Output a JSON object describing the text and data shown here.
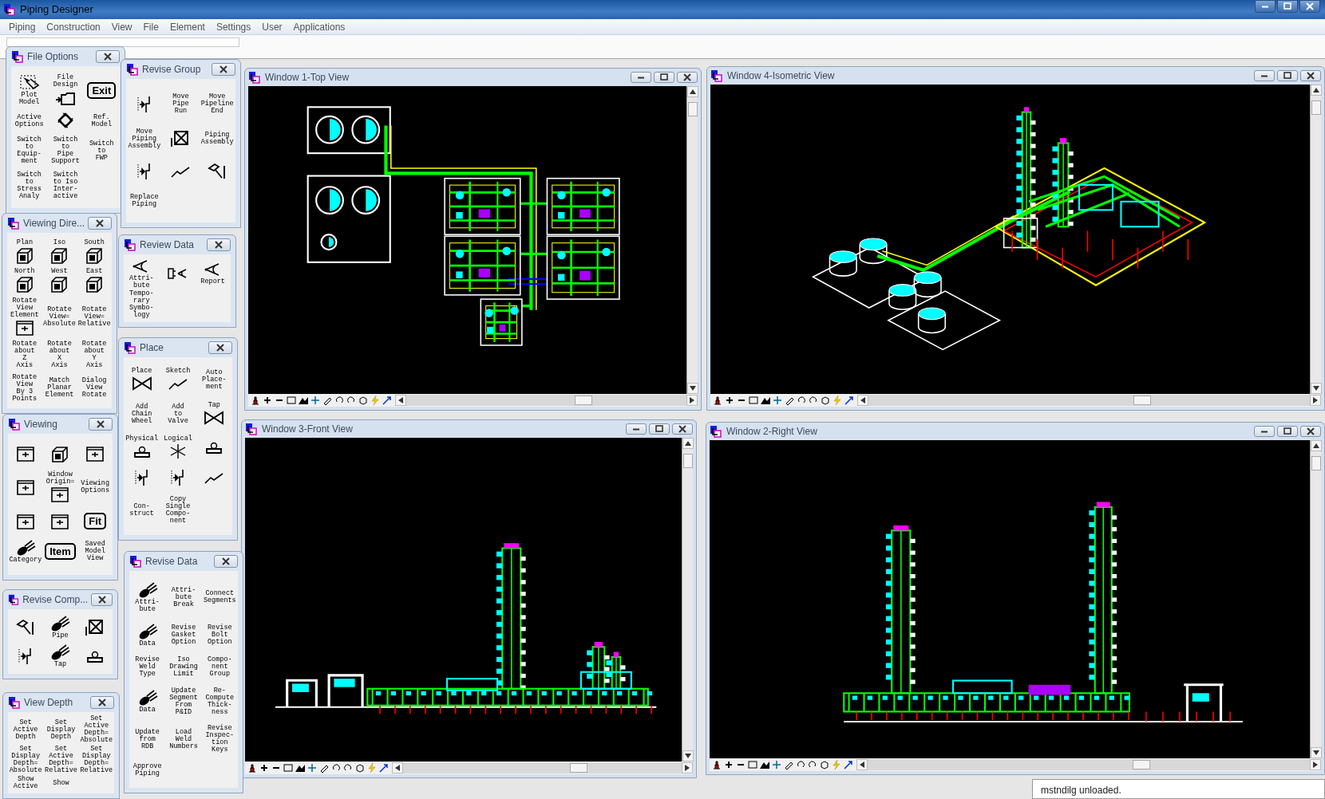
{
  "app": {
    "title": "Piping Designer"
  },
  "menu": [
    "Piping",
    "Construction",
    "View",
    "File",
    "Element",
    "Settings",
    "User",
    "Applications"
  ],
  "windows": [
    {
      "title": "Window 1-Top View",
      "kind": "top"
    },
    {
      "title": "Window 4-Isometric View",
      "kind": "iso"
    },
    {
      "title": "Window 3-Front View",
      "kind": "front"
    },
    {
      "title": "Window 2-Right View",
      "kind": "right"
    }
  ],
  "palettes": [
    {
      "title": "File Options",
      "items": [
        {
          "kind": "captioned",
          "label": "Plot\nModel"
        },
        {
          "kind": "titled",
          "label": "File\nDesign"
        },
        {
          "kind": "framed",
          "label": "Exit"
        },
        {
          "kind": "text",
          "label": "Active\nOptions"
        },
        {
          "kind": "icon"
        },
        {
          "kind": "text",
          "label": "Ref.\nModel"
        },
        {
          "kind": "text",
          "label": "Switch\nto\nEquip-\nment"
        },
        {
          "kind": "text",
          "label": "Switch\nto\nPipe\nSupport"
        },
        {
          "kind": "text",
          "label": "Switch\nto\nFWP"
        },
        {
          "kind": "text",
          "label": "Switch\nto\nStress\nAnaly"
        },
        {
          "kind": "text",
          "label": "Switch\nto Iso\nInter-\nactive"
        }
      ]
    },
    {
      "title": "Revise Group",
      "items": [
        {
          "kind": "icon"
        },
        {
          "kind": "text",
          "label": "Move\nPipe\nRun"
        },
        {
          "kind": "text",
          "label": "Move\nPipeline\nEnd"
        },
        {
          "kind": "text",
          "label": "Move\nPiping\nAssembly"
        },
        {
          "kind": "icon"
        },
        {
          "kind": "text",
          "label": "Piping\nAssembly"
        },
        {
          "kind": "icon"
        },
        {
          "kind": "icon"
        },
        {
          "kind": "icon"
        },
        {
          "kind": "text",
          "label": "Replace\nPiping"
        }
      ]
    },
    {
      "title": "Viewing Dire...",
      "items": [
        {
          "kind": "titled",
          "label": "Plan"
        },
        {
          "kind": "titled",
          "label": "Iso"
        },
        {
          "kind": "titled",
          "label": "South"
        },
        {
          "kind": "titled",
          "label": "North"
        },
        {
          "kind": "titled",
          "label": "West"
        },
        {
          "kind": "titled",
          "label": "East"
        },
        {
          "kind": "titled",
          "label": "Rotate\nView\nElement"
        },
        {
          "kind": "text",
          "label": "Rotate\nView=\nAbsolute"
        },
        {
          "kind": "text",
          "label": "Rotate\nView=\nRelative"
        },
        {
          "kind": "text",
          "label": "Rotate\nabout\nZ\nAxis"
        },
        {
          "kind": "text",
          "label": "Rotate\nabout\nX\nAxis"
        },
        {
          "kind": "text",
          "label": "Rotate\nabout\nY\nAxis"
        },
        {
          "kind": "text",
          "label": "Rotate\nView\nBy 3\nPoints"
        },
        {
          "kind": "text",
          "label": "Match\nPlanar\nElement"
        },
        {
          "kind": "text",
          "label": "Dialog\nView\nRotate"
        }
      ]
    },
    {
      "title": "Review Data",
      "items": [
        {
          "kind": "captioned",
          "label": "Attri-\nbute"
        },
        {
          "kind": "icon"
        },
        {
          "kind": "captioned",
          "label": "Report"
        },
        {
          "kind": "text",
          "label": "Tempo-\nrary\nSymbo-\nlogy"
        }
      ]
    },
    {
      "title": "Place",
      "items": [
        {
          "kind": "titled",
          "label": "Place"
        },
        {
          "kind": "titled",
          "label": "Sketch"
        },
        {
          "kind": "text",
          "label": "Auto\nPlace-\nment"
        },
        {
          "kind": "text",
          "label": "Add\nChain\nWheel"
        },
        {
          "kind": "text",
          "label": "Add\nto\nValve"
        },
        {
          "kind": "titled",
          "label": "Tap"
        },
        {
          "kind": "titled",
          "label": "Physical"
        },
        {
          "kind": "titled",
          "label": "Logical"
        },
        {
          "kind": "icon"
        },
        {
          "kind": "icon"
        },
        {
          "kind": "icon"
        },
        {
          "kind": "icon"
        },
        {
          "kind": "text",
          "label": "Con-\nstruct"
        },
        {
          "kind": "text",
          "label": "Copy\nSingle\nCompo-\nnent"
        }
      ]
    },
    {
      "title": "Viewing",
      "items": [
        {
          "kind": "icon"
        },
        {
          "kind": "icon"
        },
        {
          "kind": "icon"
        },
        {
          "kind": "icon"
        },
        {
          "kind": "titled",
          "label": "Window\nOrigin="
        },
        {
          "kind": "text",
          "label": "Viewing\nOptions"
        },
        {
          "kind": "icon"
        },
        {
          "kind": "icon"
        },
        {
          "kind": "framed",
          "label": "Fit"
        },
        {
          "kind": "captioned",
          "label": "Category"
        },
        {
          "kind": "framed",
          "label": "Item"
        },
        {
          "kind": "text",
          "label": "Saved\nModel\nView"
        }
      ]
    },
    {
      "title": "Revise Data",
      "items": [
        {
          "kind": "captioned",
          "label": "Attri-\nbute"
        },
        {
          "kind": "text",
          "label": "Attri-\nbute\nBreak"
        },
        {
          "kind": "text",
          "label": "Connect\nSegments"
        },
        {
          "kind": "captioned",
          "label": "Data"
        },
        {
          "kind": "text",
          "label": "Revise\nGasket\nOption"
        },
        {
          "kind": "text",
          "label": "Revise\nBolt\nOption"
        },
        {
          "kind": "text",
          "label": "Revise\nWeld\nType"
        },
        {
          "kind": "text",
          "label": "Iso\nDrawing\nLimit"
        },
        {
          "kind": "text",
          "label": "Compo-\nnent\nGroup"
        },
        {
          "kind": "captioned",
          "label": "Data"
        },
        {
          "kind": "text",
          "label": "Update\nSegment\nFrom\nP&ID"
        },
        {
          "kind": "text",
          "label": "Re-\nCompute\nThick-\nness"
        },
        {
          "kind": "text",
          "label": "Update\nfrom\nRDB"
        },
        {
          "kind": "text",
          "label": "Load\nWeld\nNumbers"
        },
        {
          "kind": "text",
          "label": "Revise\nInspec-\ntion\nKeys"
        },
        {
          "kind": "text",
          "label": "Approve\nPiping"
        }
      ]
    },
    {
      "title": "Revise Comp...",
      "items": [
        {
          "kind": "icon"
        },
        {
          "kind": "captioned",
          "label": "Pipe"
        },
        {
          "kind": "icon"
        },
        {
          "kind": "icon"
        },
        {
          "kind": "captioned",
          "label": "Tap"
        },
        {
          "kind": "icon"
        }
      ]
    },
    {
      "title": "View Depth",
      "items": [
        {
          "kind": "text",
          "label": "Set\nActive\nDepth"
        },
        {
          "kind": "text",
          "label": "Set\nDisplay\nDepth"
        },
        {
          "kind": "text",
          "label": "Set\nActive\nDepth=\nAbsolute"
        },
        {
          "kind": "text",
          "label": "Set\nDisplay\nDepth=\nAbsolute"
        },
        {
          "kind": "text",
          "label": "Set\nActive\nDepth=\nRelative"
        },
        {
          "kind": "text",
          "label": "Set\nDisplay\nDepth=\nRelative"
        },
        {
          "kind": "text",
          "label": "Show\nActive"
        },
        {
          "kind": "text",
          "label": "Show"
        }
      ]
    }
  ],
  "status_bar": {
    "message": "mstndilg unloaded."
  }
}
